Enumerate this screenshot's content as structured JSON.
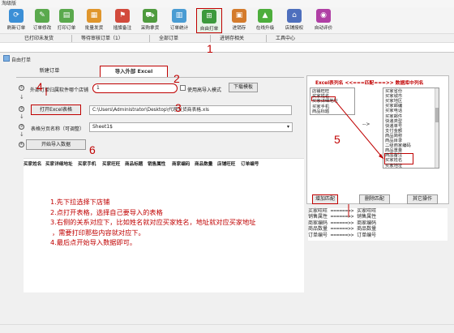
{
  "window": {
    "title": "淘级版"
  },
  "colors": {
    "accent_red": "#c00000",
    "toolbar_bg": "#f4f4f4",
    "dialog_bg": "#f0f0f0"
  },
  "toolbar": {
    "items": [
      {
        "label": "刷新订单",
        "icon": "refresh-icon",
        "glyph": "⟳",
        "color": "#3b8fd6"
      },
      {
        "label": "订单修改",
        "icon": "edit-order-icon",
        "glyph": "✎",
        "color": "#5aa94d"
      },
      {
        "label": "打印订单",
        "icon": "print-order-icon",
        "glyph": "▤",
        "color": "#5aa94d"
      },
      {
        "label": "批量发货",
        "icon": "batch-ship-icon",
        "glyph": "▦",
        "color": "#e0962c"
      },
      {
        "label": "插旗备注",
        "icon": "flag-note-icon",
        "glyph": "⚑",
        "color": "#d24a3c"
      },
      {
        "label": "采购拿货",
        "icon": "purchase-icon",
        "glyph": "⛟",
        "color": "#4f9b3e"
      },
      {
        "label": "订单统计",
        "icon": "statistics-icon",
        "glyph": "▥",
        "color": "#4a9cd3"
      },
      {
        "label": "自由打单",
        "icon": "free-print-icon",
        "glyph": "⊞",
        "color": "#3c9a3c"
      },
      {
        "label": "进销存",
        "icon": "inventory-icon",
        "glyph": "▣",
        "color": "#d47b2c"
      },
      {
        "label": "在线升级",
        "icon": "upgrade-icon",
        "glyph": "▲",
        "color": "#4dae3c"
      },
      {
        "label": "店铺授权",
        "icon": "shop-auth-icon",
        "glyph": "⌂",
        "color": "#4e6fbd"
      },
      {
        "label": "自动评价",
        "icon": "auto-review-icon",
        "glyph": "◉",
        "color": "#b03fa5"
      }
    ]
  },
  "menubar": {
    "items": [
      "已打印未发货",
      "等待审核订单（1）",
      "全部订单",
      "进销存相关",
      "工具中心"
    ]
  },
  "dialog": {
    "title": "自由打单",
    "tabs": {
      "new_order": "新建订单",
      "import_excel": "导入外部 Excel"
    },
    "shop_label": "外部订单归属软件哪个店铺",
    "shop_value": "1",
    "advanced_label": "使用高导入模式",
    "template_button": "下载模板",
    "open_excel_button": "打开Excel表格",
    "file_path": "C:\\Users\\Administrator\\Desktop\\代理发货商表格.xls",
    "sheet_label": "表格分页名称（可调整）",
    "sheet_value": "Sheet1$",
    "start_import_button": "开始导入数据",
    "step_marks": [
      "①",
      "②",
      "③",
      "④"
    ],
    "grid_columns": [
      "买家姓名",
      "买家详细地址",
      "买家手机",
      "买家旺旺",
      "商品标题",
      "销售属性",
      "商家编码",
      "商品数量",
      "店铺旺旺",
      "订单编号"
    ]
  },
  "mapping": {
    "title": "Excel表列名  <<===匹配===>>  数据库中列名",
    "excel_columns": [
      "店铺旺旺",
      "买家姓名",
      "买家详细地址",
      "买家手机",
      "商品标题"
    ],
    "db_columns": [
      "买家省份",
      "买家城市",
      "买家地区",
      "买家邮编",
      "买家电话",
      "买家邮件",
      "快递类型",
      "快递单号",
      "支付金额",
      "商品简称",
      "商品目录",
      "二级商家编码",
      "商品重量",
      "商品备注",
      "买家姓名",
      "买家地址"
    ],
    "arrow_label": "-->",
    "add_button": "增加匹配",
    "delete_button": "删除匹配",
    "other_button": "其它操作",
    "results": [
      "买家旺旺 ======>> 买家旺旺",
      "销售属性 ======>> 销售属性",
      "商家编码 ======>> 商家编码",
      "商品数量 ======>> 商品数量",
      "订单编号 ======>> 订单编号"
    ]
  },
  "annotations": {
    "n1": "1",
    "n2": "2",
    "n3": "3",
    "n4": "4",
    "n5": "5",
    "n6": "6",
    "instructions": [
      "1.先下拉选择下店铺",
      "2.点打开表格，选择自己要导入的表格",
      "3.右侧的关系对应下，比如姓名就对应买家姓名，地址就对应买家地址",
      "，需要打印那些内容就对应下。",
      "4.最后点开始导入数据即可。"
    ]
  }
}
